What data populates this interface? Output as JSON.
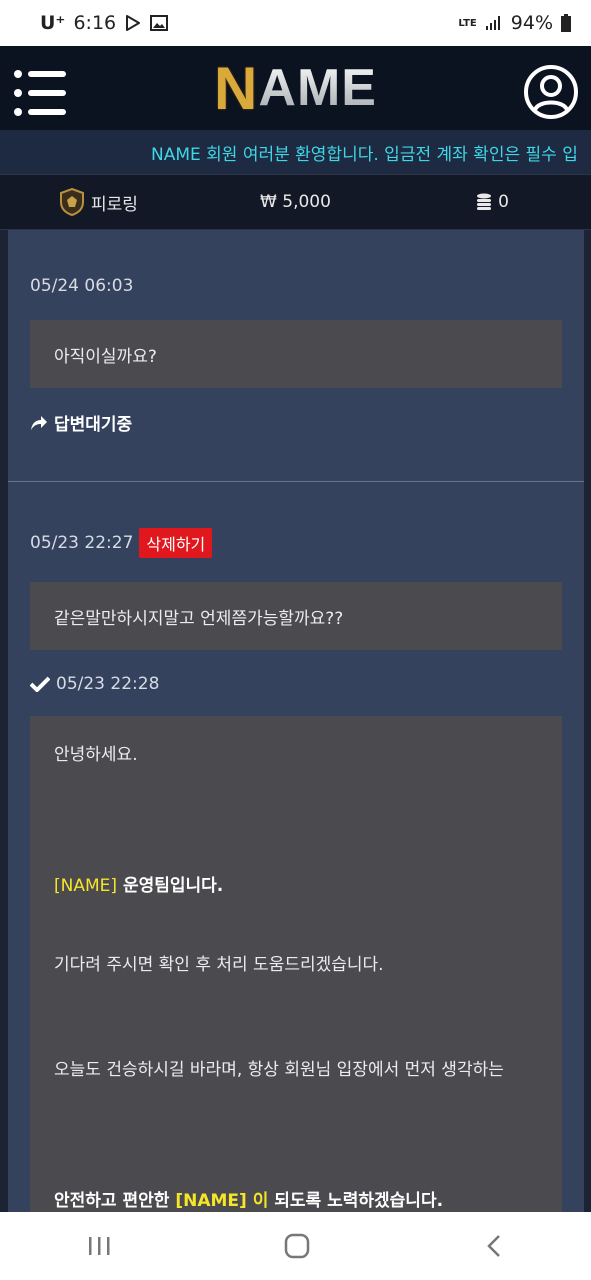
{
  "status": {
    "carrier": "U⁺",
    "time": "6:16",
    "network": "LTE",
    "battery": "94%"
  },
  "header": {
    "logo_n": "N",
    "logo_rest": "AME"
  },
  "ticker": {
    "text": "NAME 회원 여러분 환영합니다. 입금전 계좌 확인은 필수 입"
  },
  "info": {
    "rank": "피로링",
    "balance": "₩ 5,000",
    "points": "0"
  },
  "posts": [
    {
      "date": "05/24 06:03",
      "question": "아직이실까요?",
      "status": "답변대기중"
    },
    {
      "date": "05/23 22:27",
      "delete_label": "삭제하기",
      "question": "같은말만하시지말고 언제쯤가능할까요??",
      "answer_date": "05/23 22:28",
      "answer": {
        "greeting": "안녕하세요.",
        "team_tag": "[NAME]",
        "team_text": " 운영팀입니다.",
        "line2": "기다려 주시면 확인 후 처리 도움드리겠습니다.",
        "line3": "오늘도 건승하시길 바라며, 항상 회원님 입장에서 먼저 생각하는",
        "line4_a": "안전하고 편안한 ",
        "line4_tag": "[NAME] 이",
        "line4_b": " 되도록 노력하겠습니다."
      }
    }
  ],
  "icons": {
    "menu": "hamburger-menu-icon",
    "user": "user-account-icon",
    "rank": "rank-badge-icon",
    "coins": "coins-icon",
    "reply": "reply-arrow-icon",
    "check": "check-icon"
  }
}
